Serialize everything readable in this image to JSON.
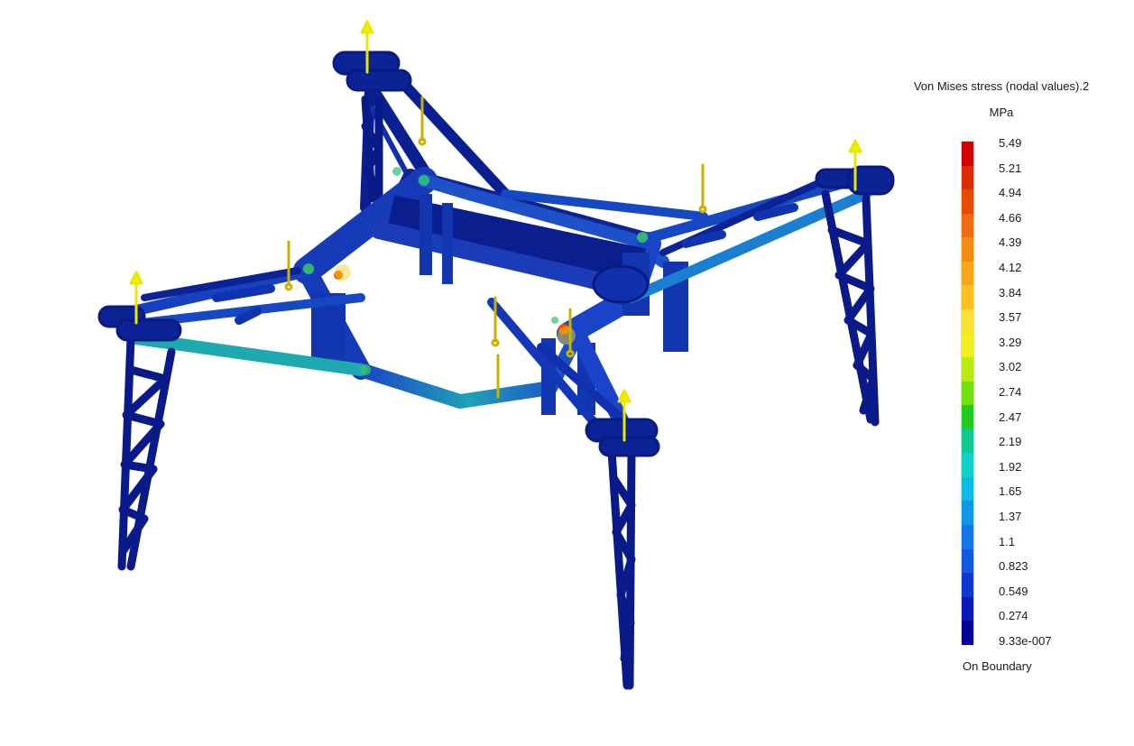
{
  "legend": {
    "title": "Von Mises stress (nodal values).2",
    "unit": "MPa",
    "footer": "On Boundary",
    "ticks": [
      "5.49",
      "5.21",
      "4.94",
      "4.66",
      "4.39",
      "4.12",
      "3.84",
      "3.57",
      "3.29",
      "3.02",
      "2.74",
      "2.47",
      "2.19",
      "1.92",
      "1.65",
      "1.37",
      "1.1",
      "0.823",
      "0.549",
      "0.274",
      "9.33e-007"
    ],
    "colors": [
      "#d40000",
      "#e02a00",
      "#e84a00",
      "#f06a10",
      "#f58a15",
      "#f8a51a",
      "#fcc020",
      "#fce030",
      "#f0f020",
      "#b8ec10",
      "#70e010",
      "#20cc20",
      "#10c890",
      "#10d0c8",
      "#10b8e8",
      "#1098e8",
      "#1478e8",
      "#1458e0",
      "#1038d0",
      "#0a1cb8",
      "#04049a"
    ]
  },
  "model": {
    "colors": {
      "structure": "#0b1e8e",
      "structure_light": "#1a3cc0",
      "accent_low": "#1a7fd0",
      "accent_mid": "#20b8a8",
      "hot": "#ff4a00",
      "warm": "#f0d020",
      "force_up": "#f0f000",
      "force_down": "#c8b400"
    }
  }
}
